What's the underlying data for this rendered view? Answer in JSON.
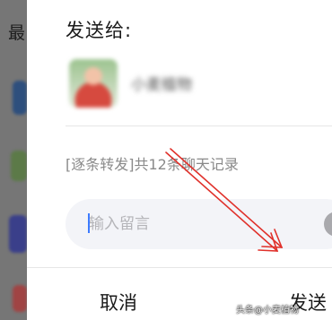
{
  "background": {
    "title_fragment": "最"
  },
  "dialog": {
    "title": "发送给:",
    "recipient": {
      "name": "小麦植物"
    },
    "forward_summary": "[逐条转发]共12条聊天记录",
    "message_input": {
      "placeholder": "输入留言",
      "value": ""
    },
    "buttons": {
      "cancel": "取消",
      "send": "发送"
    }
  },
  "watermark": "头条@小麦植物",
  "colors": {
    "annotation_arrow": "#e0312b",
    "caret": "#3d7bff",
    "input_bg": "#f3f4f8"
  },
  "icons": {
    "emoji": "emoji-icon"
  }
}
